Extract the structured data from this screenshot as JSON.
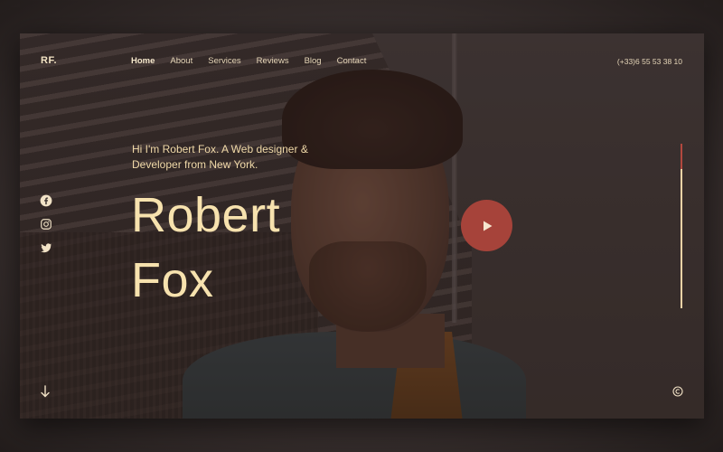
{
  "header": {
    "brand": "RF.",
    "nav": [
      {
        "label": "Home",
        "active": true
      },
      {
        "label": "About",
        "active": false
      },
      {
        "label": "Services",
        "active": false
      },
      {
        "label": "Reviews",
        "active": false
      },
      {
        "label": "Blog",
        "active": false
      },
      {
        "label": "Contact",
        "active": false
      }
    ],
    "phone": "(+33)6 55 53 38 10"
  },
  "hero": {
    "intro": "Hi I'm Robert Fox. A Web designer & Developer from New York.",
    "name_first": "Robert",
    "name_last": "Fox"
  },
  "social": {
    "icons": [
      "facebook-icon",
      "instagram-icon",
      "twitter-icon"
    ]
  },
  "controls": {
    "play_icon": "play-icon",
    "scroll_icon": "arrow-down-icon",
    "copyright_icon": "copyright-icon",
    "scroll_progress": 0.85
  },
  "colors": {
    "accent": "#a6433a",
    "text_light": "#f7e2ae",
    "overlay": "#3b3230"
  }
}
